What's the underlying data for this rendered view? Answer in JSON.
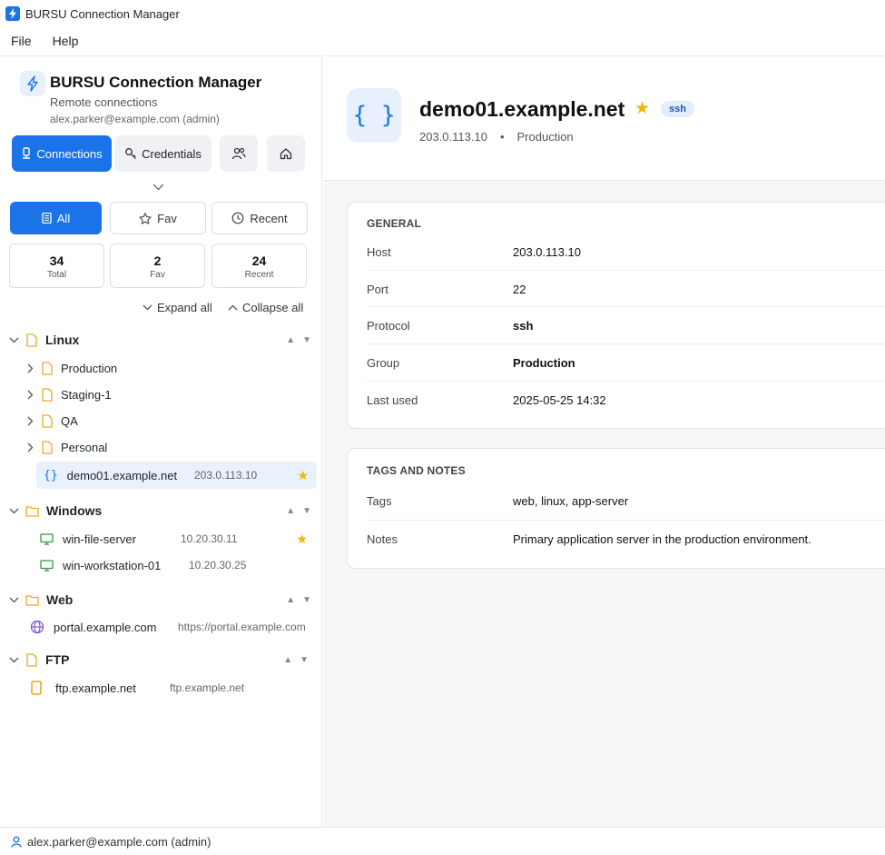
{
  "window": {
    "title": "BURSU Connection Manager"
  },
  "menu": [
    "File",
    "Help"
  ],
  "sidebar": {
    "brand": {
      "title": "BURSU Connection Manager",
      "subtitle": "Remote connections",
      "user": "alex.parker@example.com (admin)"
    },
    "nav": {
      "connections": "Connections",
      "credentials": "Credentials"
    },
    "filters": {
      "all": "All",
      "fav": "Fav",
      "recent": "Recent"
    },
    "stats": [
      {
        "value": "34",
        "label": "Total"
      },
      {
        "value": "2",
        "label": "Fav"
      },
      {
        "value": "24",
        "label": "Recent"
      }
    ],
    "expand_all": "Expand all",
    "collapse_all": "Collapse all",
    "tree": {
      "linux": {
        "label": "Linux",
        "children": [
          "Production",
          "Staging-1",
          "QA",
          "Personal"
        ],
        "item": {
          "name": "demo01.example.net",
          "addr": "203.0.113.10"
        }
      },
      "windows": {
        "label": "Windows",
        "items": [
          {
            "name": "win-file-server",
            "addr": "10.20.30.11"
          },
          {
            "name": "win-workstation-01",
            "addr": "10.20.30.25"
          }
        ]
      },
      "web": {
        "label": "Web",
        "items": [
          {
            "name": "portal.example.com",
            "addr": "https://portal.example.com"
          }
        ]
      },
      "ftp": {
        "label": "FTP",
        "items": [
          {
            "name": "ftp.example.net",
            "addr": "ftp.example.net"
          }
        ]
      }
    }
  },
  "detail": {
    "icon_glyph": "{ }",
    "title": "demo01.example.net",
    "badge": "ssh",
    "address": "203.0.113.10",
    "separator": "•",
    "group": "Production",
    "general": {
      "heading": "GENERAL",
      "rows": [
        {
          "k": "Host",
          "v": "203.0.113.10"
        },
        {
          "k": "Port",
          "v": "22"
        },
        {
          "k": "Protocol",
          "v": "ssh"
        },
        {
          "k": "Group",
          "v": "Production"
        },
        {
          "k": "Last used",
          "v": "2025-05-25 14:32"
        }
      ]
    },
    "tags": {
      "heading": "TAGS AND NOTES",
      "rows": [
        {
          "k": "Tags",
          "v": "web, linux, app-server"
        },
        {
          "k": "Notes",
          "v": "Primary application server in the production environment."
        }
      ]
    }
  },
  "status": {
    "user": "alex.parker@example.com (admin)"
  },
  "colors": {
    "accent": "#1a73e8",
    "star": "#f5b400",
    "folder": "#f5a623",
    "monitor": "#2e9a3e",
    "globe": "#7b4fd6",
    "ftp": "#f5a623"
  }
}
